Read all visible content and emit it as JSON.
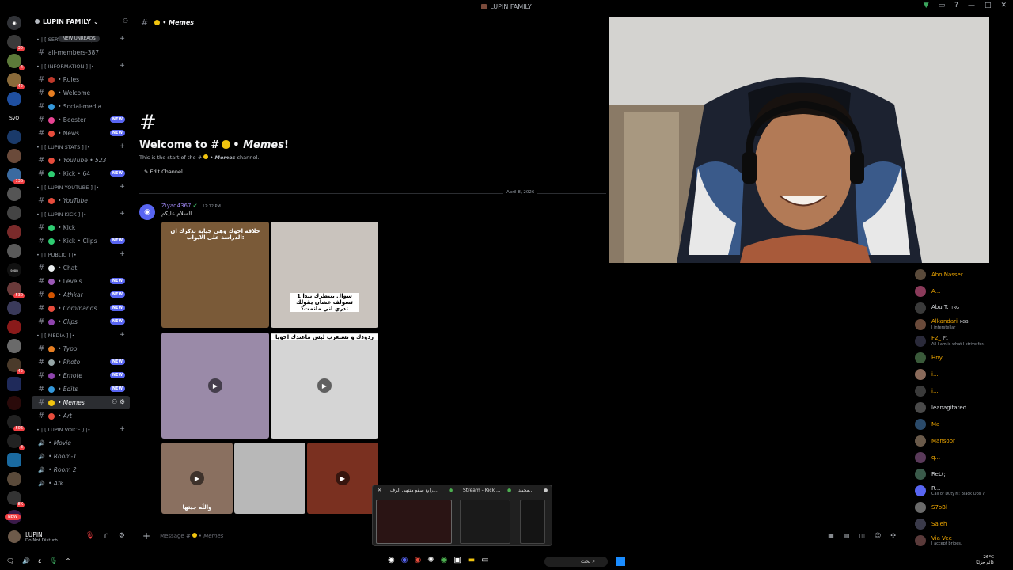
{
  "window": {
    "title": "LUPIN FAMILY"
  },
  "server": {
    "name": "LUPIN FAMILY",
    "new_unreads": "NEW UNREADS"
  },
  "channels": [
    {
      "type": "category",
      "label": "• | [ SERVER STATS ] |•"
    },
    {
      "type": "channel",
      "label": "all-members-387"
    },
    {
      "type": "category",
      "label": "• | [ INFORMATION ] |•"
    },
    {
      "type": "channel",
      "label": "• Rules",
      "color": "#c0392b"
    },
    {
      "type": "channel",
      "label": "• Welcome",
      "color": "#e67e22"
    },
    {
      "type": "channel",
      "label": "• Social-media",
      "color": "#3498db"
    },
    {
      "type": "channel",
      "label": "• Booster",
      "color": "#e84393",
      "badge": "NEW"
    },
    {
      "type": "channel",
      "label": "• News",
      "color": "#e74c3c",
      "badge": "NEW"
    },
    {
      "type": "category",
      "label": "• | [ LUPIN STATS ] |•"
    },
    {
      "type": "channel",
      "label": "• YouTube • 523",
      "color": "#e74c3c",
      "italic": true
    },
    {
      "type": "channel",
      "label": "• Kick • 64",
      "color": "#2ecc71",
      "badge": "NEW"
    },
    {
      "type": "category",
      "label": "• | [ LUPIN YOUTUBE ] |•"
    },
    {
      "type": "channel",
      "label": "• YouTube",
      "color": "#e74c3c",
      "italic": true
    },
    {
      "type": "category",
      "label": "• | [ LUPIN KICK ] |•"
    },
    {
      "type": "channel",
      "label": "• Kick",
      "color": "#2ecc71"
    },
    {
      "type": "channel",
      "label": "• Kick • Clips",
      "color": "#2ecc71",
      "badge": "NEW"
    },
    {
      "type": "category",
      "label": "• | [ PUBLIC ] |•"
    },
    {
      "type": "channel",
      "label": "• Chat",
      "color": "#ecf0f1"
    },
    {
      "type": "channel",
      "label": "• Levels",
      "color": "#9b59b6",
      "badge": "NEW"
    },
    {
      "type": "channel",
      "label": "• Athkar",
      "color": "#d35400",
      "badge": "NEW",
      "italic": true
    },
    {
      "type": "channel",
      "label": "• Commands",
      "color": "#e74c3c",
      "badge": "NEW",
      "italic": true
    },
    {
      "type": "channel",
      "label": "• Clips",
      "color": "#8e44ad",
      "badge": "NEW",
      "italic": true
    },
    {
      "type": "category",
      "label": "• | [ MEDIA ] |•"
    },
    {
      "type": "channel",
      "label": "• Typo",
      "color": "#e67e22",
      "italic": true
    },
    {
      "type": "channel",
      "label": "• Photo",
      "color": "#95a5a6",
      "badge": "NEW",
      "italic": true
    },
    {
      "type": "channel",
      "label": "• Emote",
      "color": "#8e44ad",
      "badge": "NEW",
      "italic": true
    },
    {
      "type": "channel",
      "label": "• Edits",
      "color": "#3498db",
      "badge": "NEW",
      "italic": true
    },
    {
      "type": "channel",
      "label": "• Memes",
      "color": "#f1c40f",
      "active": true,
      "italic": true
    },
    {
      "type": "channel",
      "label": "• Art",
      "color": "#e74c3c",
      "italic": true
    },
    {
      "type": "category",
      "label": "• | [ LUPIN VOICE ] |•"
    },
    {
      "type": "voice",
      "label": "• Movie",
      "italic": true
    },
    {
      "type": "voice",
      "label": "• Room-1",
      "italic": true
    },
    {
      "type": "voice",
      "label": "• Room 2",
      "italic": true
    },
    {
      "type": "voice",
      "label": "• Afk",
      "italic": true
    }
  ],
  "user": {
    "name": "LUPIN",
    "status": "Do Not Disturb",
    "new_badge": "NEW"
  },
  "chat": {
    "channel_title": "• Memes",
    "welcome_prefix": "Welcome to #",
    "welcome_channel": "• Memes",
    "welcome_suffix": "!",
    "start_text": "This is the start of the #",
    "start_channel": "• Memes",
    "start_suffix": " channel.",
    "edit_channel": "Edit Channel",
    "date_divider": "April 8, 2026",
    "composer_placeholder": "Message #",
    "composer_channel": "• Memes"
  },
  "message": {
    "author": "Ziyad4367",
    "time": "12:12 PM",
    "text": "السلام عليكم",
    "tiles": [
      {
        "caption": "حلاقة اخوك وهي جيايه تذكرك ان الدراسة على الابواب:",
        "bg": "#7a5a38"
      },
      {
        "caption": "1 شوال ينتظرك تبدا تسولف عشان يقولك تدري اني مانمت؟",
        "bg": "#c9c3bd"
      },
      {
        "caption": "",
        "bg": "#9a8aa8",
        "video": true
      },
      {
        "caption": "ردودك و تستغرب ليش ماعندك اخويا",
        "bg": "#d5d5d5",
        "video": true
      },
      {
        "caption": "واللّه جيتها",
        "bg": "#8a7060",
        "video": true
      },
      {
        "caption": "",
        "bg": "#b8b8b8"
      },
      {
        "caption": "",
        "bg": "#7a3020",
        "video": true
      }
    ]
  },
  "members": [
    {
      "name": "Abo Nasser",
      "color": "#f2a900",
      "status": ""
    },
    {
      "name": "A...",
      "color": "#f2a900",
      "status": ""
    },
    {
      "name": "Abu T.",
      "color": "#dbdee1",
      "status": "",
      "tag": "TRG"
    },
    {
      "name": "Alkandari",
      "color": "#f2a900",
      "status": "I interstellar",
      "tag": "KGB"
    },
    {
      "name": "F2_",
      "color": "#f2a900",
      "status": "All I am is what I strive for.",
      "tag": "F1"
    },
    {
      "name": "Hny",
      "color": "#f2a900",
      "status": ""
    },
    {
      "name": "i...",
      "color": "#f2a900",
      "status": ""
    },
    {
      "name": "i...",
      "color": "#f2a900",
      "status": ""
    },
    {
      "name": "leanagitated",
      "color": "#dbdee1",
      "status": ""
    },
    {
      "name": "Ma",
      "color": "#f2a900",
      "status": ""
    },
    {
      "name": "Mansoor",
      "color": "#f2a900",
      "status": ""
    },
    {
      "name": "q...",
      "color": "#f2a900",
      "status": ""
    },
    {
      "name": "ReL(;",
      "color": "#dbdee1",
      "status": ""
    },
    {
      "name": "R...",
      "color": "#dbdee1",
      "status": "Call of Duty®: Black Ops 7"
    },
    {
      "name": "S7oBl",
      "color": "#f2a900",
      "status": ""
    },
    {
      "name": "Saleh",
      "color": "#f2a900",
      "status": ""
    },
    {
      "name": "Via Vee",
      "color": "#f2a900",
      "status": "I accept bribes."
    }
  ],
  "task_preview": {
    "t1": "رابع صفو منتهى الرف...",
    "t2": "Stream - Kick ...",
    "t3": "محمد..."
  },
  "taskbar": {
    "search": "بحث",
    "clock_line1": "26°C",
    "clock_line2": "غائم جزئيًا"
  }
}
